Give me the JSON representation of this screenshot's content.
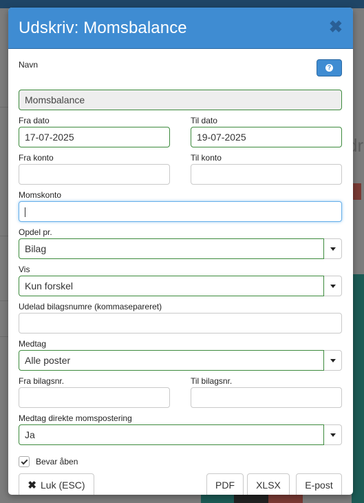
{
  "modal": {
    "title": "Udskriv: Momsbalance",
    "close_icon": "close-icon",
    "help_icon": "question-circle-icon",
    "help_glyph": "?"
  },
  "form": {
    "navn": {
      "label": "Navn",
      "value": "Momsbalance"
    },
    "fra_dato": {
      "label": "Fra dato",
      "value": "17-07-2025"
    },
    "til_dato": {
      "label": "Til dato",
      "value": "19-07-2025"
    },
    "fra_konto": {
      "label": "Fra konto",
      "value": ""
    },
    "til_konto": {
      "label": "Til konto",
      "value": ""
    },
    "momskonto": {
      "label": "Momskonto",
      "value": ""
    },
    "opdel": {
      "label": "Opdel pr.",
      "value": "Bilag"
    },
    "vis": {
      "label": "Vis",
      "value": "Kun forskel"
    },
    "udelad": {
      "label": "Udelad bilagsnumre (kommasepareret)",
      "value": ""
    },
    "medtag": {
      "label": "Medtag",
      "value": "Alle poster"
    },
    "fra_bilag": {
      "label": "Fra bilagsnr.",
      "value": ""
    },
    "til_bilag": {
      "label": "Til bilagsnr.",
      "value": ""
    },
    "direkte": {
      "label": "Medtag direkte momspostering",
      "value": "Ja"
    },
    "bevar": {
      "label": "Bevar åben",
      "checked": true
    }
  },
  "footer": {
    "close_label": "Luk (ESC)",
    "pdf_label": "PDF",
    "xlsx_label": "XLSX",
    "email_label": "E-post"
  },
  "background": {
    "fragment": "dr"
  },
  "colors": {
    "header_blue": "#3f8cd2",
    "valid_green": "#3c8a3c",
    "focus_blue": "#66afe9"
  }
}
